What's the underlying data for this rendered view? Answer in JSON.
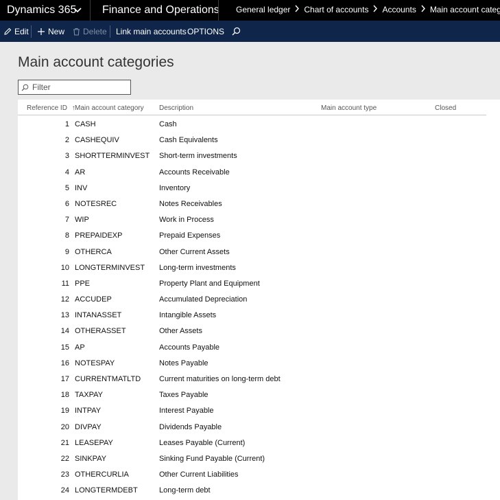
{
  "topbar": {
    "app_name": "Dynamics 365",
    "module": "Finance and Operations",
    "breadcrumb": [
      "General ledger",
      "Chart of accounts",
      "Accounts",
      "Main account categories"
    ]
  },
  "actions": {
    "edit": "Edit",
    "new": "New",
    "delete": "Delete",
    "link": "Link main accounts",
    "options": "OPTIONS"
  },
  "page": {
    "title": "Main account categories",
    "filter_placeholder": "Filter"
  },
  "grid": {
    "columns": [
      "Reference ID",
      "Main account category",
      "Description",
      "Main account type",
      "Closed"
    ],
    "sort_indicator": "↑",
    "rows": [
      {
        "id": "1",
        "category": "CASH",
        "description": "Cash"
      },
      {
        "id": "2",
        "category": "CASHEQUIV",
        "description": "Cash Equivalents"
      },
      {
        "id": "3",
        "category": "SHORTTERMINVEST",
        "description": "Short-term investments"
      },
      {
        "id": "4",
        "category": "AR",
        "description": "Accounts Receivable"
      },
      {
        "id": "5",
        "category": "INV",
        "description": "Inventory"
      },
      {
        "id": "6",
        "category": "NOTESREC",
        "description": "Notes Receivables"
      },
      {
        "id": "7",
        "category": "WIP",
        "description": "Work in Process"
      },
      {
        "id": "8",
        "category": "PREPAIDEXP",
        "description": "Prepaid Expenses"
      },
      {
        "id": "9",
        "category": "OTHERCA",
        "description": "Other Current Assets"
      },
      {
        "id": "10",
        "category": "LONGTERMINVEST",
        "description": "Long-term investments"
      },
      {
        "id": "11",
        "category": "PPE",
        "description": "Property Plant and Equipment"
      },
      {
        "id": "12",
        "category": "ACCUDEP",
        "description": "Accumulated Depreciation"
      },
      {
        "id": "13",
        "category": "INTANASSET",
        "description": "Intangible Assets"
      },
      {
        "id": "14",
        "category": "OTHERASSET",
        "description": "Other Assets"
      },
      {
        "id": "15",
        "category": "AP",
        "description": "Accounts Payable"
      },
      {
        "id": "16",
        "category": "NOTESPAY",
        "description": "Notes Payable"
      },
      {
        "id": "17",
        "category": "CURRENTMATLTD",
        "description": "Current maturities on long-term debt"
      },
      {
        "id": "18",
        "category": "TAXPAY",
        "description": "Taxes Payable"
      },
      {
        "id": "19",
        "category": "INTPAY",
        "description": "Interest Payable"
      },
      {
        "id": "20",
        "category": "DIVPAY",
        "description": "Dividends Payable"
      },
      {
        "id": "21",
        "category": "LEASEPAY",
        "description": "Leases Payable (Current)"
      },
      {
        "id": "22",
        "category": "SINKPAY",
        "description": "Sinking Fund Payable (Current)"
      },
      {
        "id": "23",
        "category": "OTHERCURLIA",
        "description": "Other Current Liabilities"
      },
      {
        "id": "24",
        "category": "LONGTERMDEBT",
        "description": "Long-term debt"
      }
    ]
  },
  "icons": {
    "app_switcher": "chevron-down-icon",
    "breadcrumb_separator": "chevron-right-icon",
    "edit": "pencil-icon",
    "new": "plus-icon",
    "delete": "trash-icon",
    "search": "search-icon",
    "filter": "search-icon"
  },
  "colors": {
    "topbar": "#000000",
    "actionbar": "#0f2549",
    "header_bg": "#eaeaea"
  }
}
